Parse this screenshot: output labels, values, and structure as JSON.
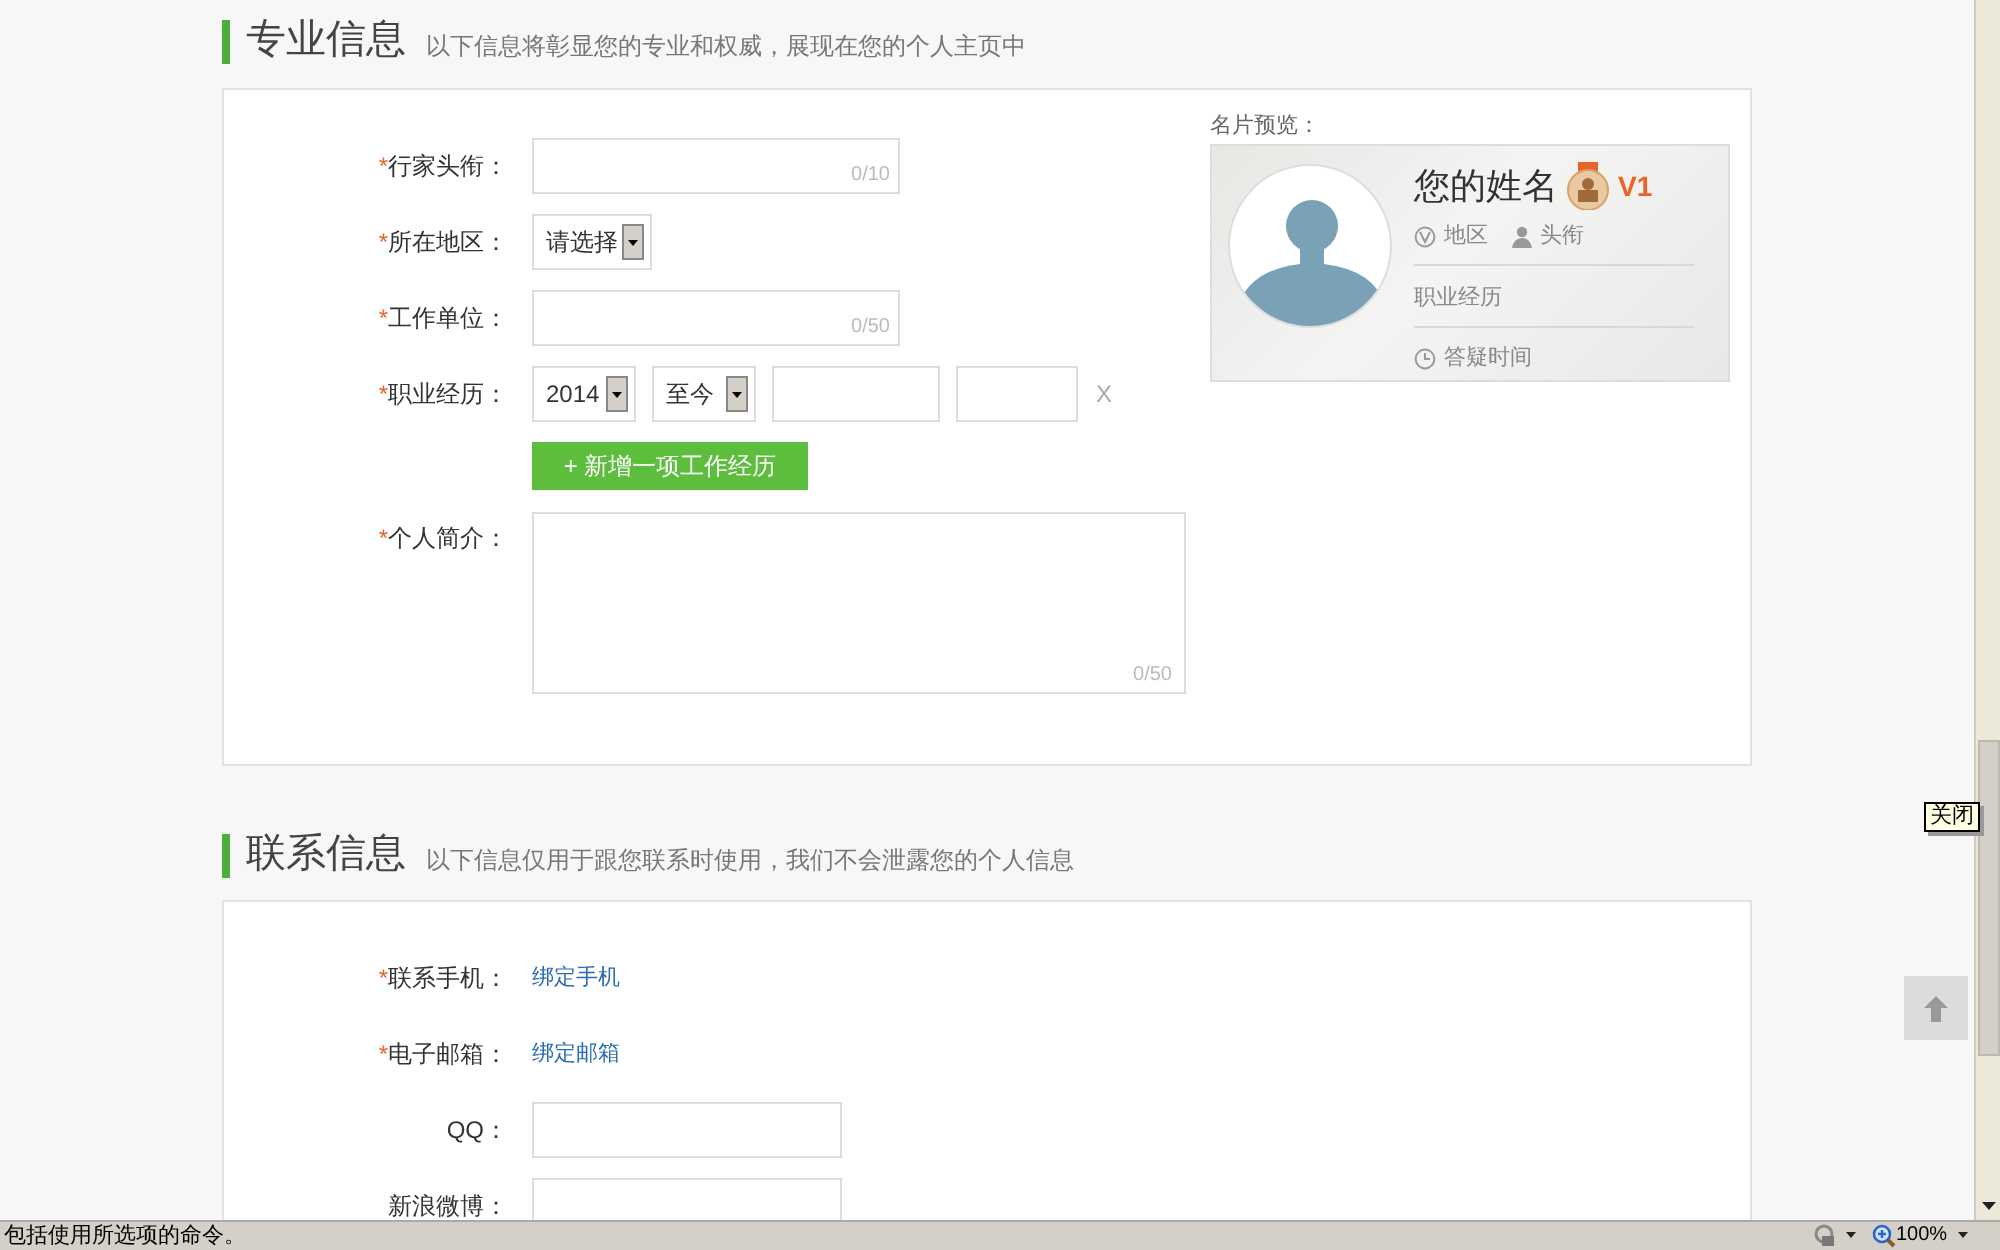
{
  "sections": [
    {
      "title": "专业信息",
      "subtitle": "以下信息将彰显您的专业和权威，展现在您的个人主页中",
      "fields": [
        {
          "kind": "text",
          "mark": "*",
          "label": "行家头衔：",
          "counter": "0/10"
        },
        {
          "kind": "select",
          "mark": "*",
          "label": "所在地区：",
          "value": "请选择"
        },
        {
          "kind": "text",
          "mark": "*",
          "label": "工作单位：",
          "counter": "0/50"
        },
        {
          "kind": "experience",
          "mark": "*",
          "label": "职业经历：",
          "start": "2014",
          "end": "至今",
          "remove": "X",
          "add_button": "+ 新增一项工作经历"
        },
        {
          "kind": "textarea",
          "mark": "*",
          "label": "个人简介：",
          "counter": "0/50"
        }
      ],
      "preview": {
        "label": "名片预览：",
        "name": "您的姓名",
        "level": "V1",
        "region": "地区",
        "headline": "头衔",
        "experience": "职业经历",
        "hours": "答疑时间"
      }
    },
    {
      "title": "联系信息",
      "subtitle": "以下信息仅用于跟您联系时使用，我们不会泄露您的个人信息",
      "fields": [
        {
          "kind": "link",
          "mark": "*",
          "label": "联系手机：",
          "link": "绑定手机"
        },
        {
          "kind": "link",
          "mark": "*",
          "label": "电子邮箱：",
          "link": "绑定邮箱"
        },
        {
          "kind": "input",
          "label": "QQ："
        },
        {
          "kind": "input",
          "label": "新浪微博："
        }
      ]
    }
  ],
  "close_tip": "关闭",
  "status_bar": {
    "text": "包括使用所选项的命令。",
    "zoom": "100%"
  }
}
